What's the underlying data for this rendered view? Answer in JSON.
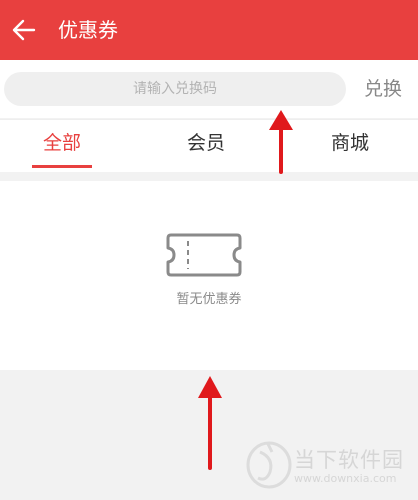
{
  "header": {
    "title": "优惠券",
    "back_icon": "arrow-left-icon"
  },
  "search": {
    "placeholder": "请输入兑换码",
    "redeem_label": "兑换"
  },
  "tabs": [
    {
      "label": "全部",
      "active": true
    },
    {
      "label": "会员",
      "active": false
    },
    {
      "label": "商城",
      "active": false
    }
  ],
  "empty": {
    "icon": "ticket-icon",
    "text": "暂无优惠券"
  },
  "watermark": {
    "name": "当下软件园",
    "url": "www.downxia.com"
  },
  "colors": {
    "accent": "#e8403f",
    "annotation_arrow": "#e0191c"
  }
}
